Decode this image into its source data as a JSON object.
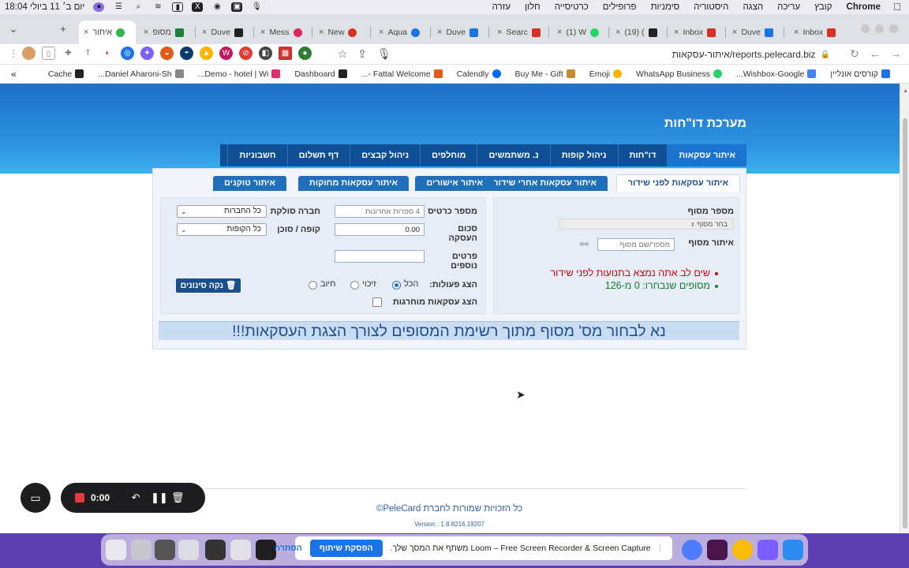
{
  "menubar": {
    "app": "Chrome",
    "items": [
      "קובץ",
      "עריכה",
      "הצגה",
      "היסטוריה",
      "סימניות",
      "פרופילים",
      "כרטיסייה",
      "חלון",
      "עזרה"
    ],
    "clock": "יום ב׳ 11 ביולי 18:04"
  },
  "tabs": [
    {
      "label": "איתור",
      "active": true,
      "color": "#2fb84a"
    },
    {
      "label": "מסופ",
      "color": "#188038"
    },
    {
      "label": "Duve",
      "color": "#222"
    },
    {
      "label": "Mess",
      "color": "#e0245e"
    },
    {
      "label": "New",
      "color": "#d93025"
    },
    {
      "label": "Aqua",
      "color": "#1a73e8"
    },
    {
      "label": "Duve",
      "color": "#1a73e8"
    },
    {
      "label": "Searc",
      "color": "#d93025"
    },
    {
      "label": "(1) W",
      "color": "#25d366"
    },
    {
      "label": "(19) (",
      "color": "#222"
    },
    {
      "label": "Inbox",
      "color": "#d93025"
    },
    {
      "label": "Duve",
      "color": "#1a73e8"
    },
    {
      "label": "Inbox",
      "color": "#d93025"
    }
  ],
  "address": {
    "url": "reports.pelecard.biz/איתור-עסקאות"
  },
  "bookmarks": [
    {
      "label": "קורסים אונליין",
      "color": "#1a73e8"
    },
    {
      "label": "Wishbox-Google...",
      "color": "#4285f4"
    },
    {
      "label": "WhatsApp Business",
      "color": "#25d366"
    },
    {
      "label": "Emoji",
      "color": "#f4b400"
    },
    {
      "label": "Buy Me - Gift",
      "color": "#f4b400"
    },
    {
      "label": "Calendly",
      "color": "#006bff"
    },
    {
      "label": "Fattal Welcome -...",
      "color": "#e35a14"
    },
    {
      "label": "Dashboard",
      "color": "#222"
    },
    {
      "label": "Demo - hotel | Wi...",
      "color": "#d93070"
    },
    {
      "label": "Daniel Aharoni-Sh...",
      "color": "#555"
    },
    {
      "label": "Cache",
      "color": "#222"
    }
  ],
  "page": {
    "system_title": "מערכת דו\"חות",
    "main_nav": [
      "איתור עסקאות",
      "דו\"חות",
      "ניהול קופות",
      "נ. משתמשים",
      "מוחלפים",
      "ניהול קבצים",
      "דף תשלום",
      "חשבוניות"
    ],
    "sub_tabs": [
      "איתור עסקאות לפני שידור",
      "איתור עסקאות אחרי שידור",
      "איתור אישורים",
      "איתור עסקאות מחוקות",
      "איתור טוקנים"
    ],
    "terminal_label": "מספר מסוף",
    "terminal_select": "בחר מסוף",
    "terminal_search_label": "איתור מסוף",
    "terminal_search_placeholder": "מספר/שם מסוף",
    "warning_text": "שים לב אתה נמצא בתנועות לפני שידור",
    "selected_text": "מסופים שנבחרו: 0 מ-126",
    "card_label": "מספר כרטיס",
    "card_placeholder": "4 ספרות אחרונות",
    "amount_label": "סכום העסקה",
    "amount_value": "0.00",
    "details_label": "פרטים נוספים",
    "company_label": "חברה סולקת",
    "company_value": "כל החברות",
    "register_label": "קופה / סוכן",
    "register_value": "כל הקופות",
    "show_actions_label": "הצג פעולות:",
    "radio_all": "הכל",
    "radio_credit": "זיכוי",
    "radio_debit": "חיוב",
    "show_ext_label": "הצג עסקאות מוחרגות",
    "clear_button": "נקה סינונים",
    "notice": "נא לבחור מס' מסוף מתוך רשימת המסופים לצורך הצגת העסקאות!!!",
    "copyright": "כל הזכויות שמורות לחברת PeleCard©",
    "version": "Version : 1.8.8216.19207"
  },
  "loom": {
    "time": "0:00"
  },
  "sharebar": {
    "message": "Loom – Free Screen Recorder & Screen Capture משתף את המסך שלך.",
    "stop_label": "הפסקת שיתוף",
    "hide_label": "הסתרה"
  },
  "colors": {
    "banner": "#2d94e1",
    "nav": "#0f4f93",
    "warning": "#d6000c",
    "ok": "#137d2b"
  }
}
